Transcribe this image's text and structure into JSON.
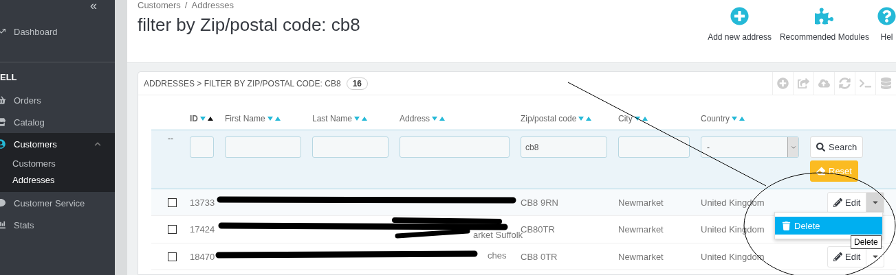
{
  "sidebar": {
    "collapse": "«",
    "items": [
      {
        "label": "Dashboard",
        "kind": "link",
        "selected": false,
        "expanded": false
      },
      {
        "label": "ELL",
        "kind": "section"
      },
      {
        "label": "Orders",
        "kind": "link",
        "selected": false,
        "expanded": false
      },
      {
        "label": "Catalog",
        "kind": "link",
        "selected": false,
        "expanded": false
      },
      {
        "label": "Customers",
        "kind": "link",
        "selected": true,
        "expanded": true,
        "children": [
          {
            "label": "Customers",
            "selected": false
          },
          {
            "label": "Addresses",
            "selected": true
          }
        ]
      },
      {
        "label": "Customer Service",
        "kind": "link",
        "selected": false,
        "expanded": false
      },
      {
        "label": "Stats",
        "kind": "link",
        "selected": false,
        "expanded": false
      }
    ]
  },
  "breadcrumb": [
    "Customers",
    "Addresses"
  ],
  "breadcrumb_separator": "/",
  "page_title": "filter by Zip/postal code: cb8",
  "toolbar": [
    {
      "label": "Add new address",
      "kind": "add"
    },
    {
      "label": "Recommended Modules",
      "kind": "modules"
    },
    {
      "label": "Hel",
      "kind": "help"
    }
  ],
  "panel": {
    "title": "ADDRESSES > FILTER BY ZIP/POSTAL CODE: CB8",
    "count": "16"
  },
  "table": {
    "columns": [
      {
        "label": "ID",
        "sorted": true
      },
      {
        "label": "First Name",
        "sorted": false
      },
      {
        "label": "Last Name",
        "sorted": false
      },
      {
        "label": "Address",
        "sorted": false
      },
      {
        "label": "Zip/postal code",
        "sorted": false
      },
      {
        "label": "City",
        "sorted": false
      },
      {
        "label": "Country",
        "sorted": false
      }
    ],
    "bulk_marker": "--",
    "filters": {
      "zip": "cb8",
      "country": "-"
    },
    "search_button": "Search",
    "reset_button": "Reset",
    "rows": [
      {
        "id": "13733",
        "zip": "CB8 9RN",
        "city": "Newmarket",
        "country": "United Kingdom",
        "checked": false,
        "actions": {
          "edit": "Edit",
          "menu_open": true
        }
      },
      {
        "id": "17424",
        "address": "arket Suffolk",
        "zip": "CB80TR",
        "city": "Newmarket",
        "country": "United Kingdom",
        "checked": false
      },
      {
        "id": "18470",
        "address": "ches",
        "zip": "CB8 0TR",
        "city": "Newmarket",
        "country": "United Kingdom",
        "checked": false,
        "actions": {
          "edit": "Edit",
          "menu_open": false
        }
      }
    ],
    "menu_item": "Delete",
    "tooltip": "Delete"
  }
}
